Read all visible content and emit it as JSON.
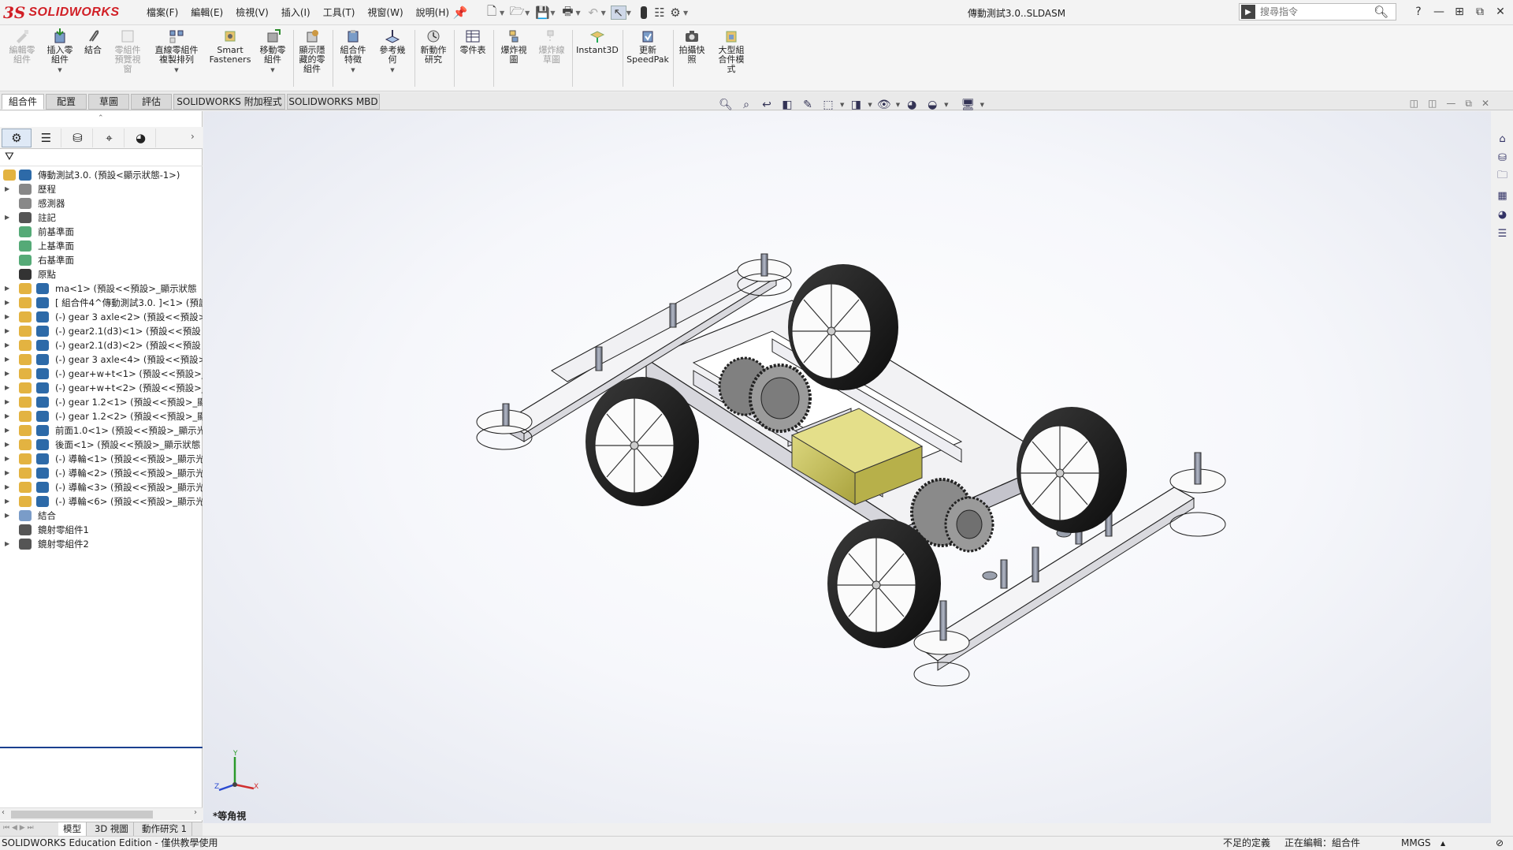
{
  "app": {
    "brand_ds": "3S",
    "brand_name": "SOLIDWORKS",
    "document_title": "傳動測試3.0..SLDASM"
  },
  "menu": [
    "檔案(F)",
    "編輯(E)",
    "檢視(V)",
    "插入(I)",
    "工具(T)",
    "視窗(W)",
    "說明(H)"
  ],
  "search": {
    "placeholder": "搜尋指令"
  },
  "window_controls": [
    "?",
    "—",
    "⊞",
    "⧉",
    "✕"
  ],
  "ribbon": [
    {
      "label": "編輯零\n組件",
      "disabled": true
    },
    {
      "label": "插入零\n組件",
      "disabled": false
    },
    {
      "label": "結合",
      "disabled": false
    },
    {
      "label": "零組件\n預覽視\n窗",
      "disabled": true
    },
    {
      "label": "直線零組件\n複製排列",
      "disabled": false
    },
    {
      "label": "Smart\nFasteners",
      "disabled": false
    },
    {
      "label": "移動零\n組件",
      "disabled": false
    },
    {
      "label": "顯示隱\n藏的零\n組件",
      "disabled": false
    },
    {
      "label": "組合件\n特徵",
      "disabled": false
    },
    {
      "label": "參考幾\n何",
      "disabled": false
    },
    {
      "label": "新動作\n研究",
      "disabled": false
    },
    {
      "label": "零件表",
      "disabled": false
    },
    {
      "label": "爆炸視\n圖",
      "disabled": false
    },
    {
      "label": "爆炸線\n草圖",
      "disabled": true
    },
    {
      "label": "Instant3D",
      "disabled": false
    },
    {
      "label": "更新\nSpeedPak",
      "disabled": false
    },
    {
      "label": "拍攝快\n照",
      "disabled": false
    },
    {
      "label": "大型組\n合件模\n式",
      "disabled": false
    }
  ],
  "command_tabs": [
    "組合件",
    "配置",
    "草圖",
    "評估",
    "SOLIDWORKS 附加程式",
    "SOLIDWORKS MBD"
  ],
  "tree": [
    {
      "label": "傳動測試3.0. (預設<顯示狀態-1>)",
      "kind": "root"
    },
    {
      "label": "歷程",
      "kind": "history"
    },
    {
      "label": "感測器",
      "kind": "sensor"
    },
    {
      "label": "註記",
      "kind": "annotation"
    },
    {
      "label": "前基準面",
      "kind": "plane"
    },
    {
      "label": "上基準面",
      "kind": "plane"
    },
    {
      "label": "右基準面",
      "kind": "plane"
    },
    {
      "label": "原點",
      "kind": "origin"
    },
    {
      "label": "ma<1> (預設<<預設>_顯示狀態",
      "kind": "part"
    },
    {
      "label": "[ 組合件4^傳動測試3.0. ]<1> (預設",
      "kind": "subasm"
    },
    {
      "label": "(-) gear 3 axle<2> (預設<<預設>",
      "kind": "part"
    },
    {
      "label": "(-) gear2.1(d3)<1> (預設<<預設",
      "kind": "part"
    },
    {
      "label": "(-) gear2.1(d3)<2> (預設<<預設",
      "kind": "part"
    },
    {
      "label": "(-) gear 3 axle<4> (預設<<預設>",
      "kind": "part"
    },
    {
      "label": "(-) gear+w+t<1> (預設<<預設>_",
      "kind": "part"
    },
    {
      "label": "(-) gear+w+t<2> (預設<<預設>_",
      "kind": "part"
    },
    {
      "label": "(-) gear 1.2<1> (預設<<預設>_顯",
      "kind": "part"
    },
    {
      "label": "(-) gear 1.2<2> (預設<<預設>_顯",
      "kind": "part"
    },
    {
      "label": "前面1.0<1> (預設<<預設>_顯示光",
      "kind": "part"
    },
    {
      "label": "後面<1> (預設<<預設>_顯示狀態",
      "kind": "part"
    },
    {
      "label": "(-) 導輪<1> (預設<<預設>_顯示光",
      "kind": "part"
    },
    {
      "label": "(-) 導輪<2> (預設<<預設>_顯示光",
      "kind": "part"
    },
    {
      "label": "(-) 導輪<3> (預設<<預設>_顯示光",
      "kind": "part"
    },
    {
      "label": "(-) 導輪<6> (預設<<預設>_顯示光",
      "kind": "part"
    },
    {
      "label": "結合",
      "kind": "mates"
    },
    {
      "label": "鏡射零組件1",
      "kind": "mirror"
    },
    {
      "label": "鏡射零組件2",
      "kind": "mirror"
    }
  ],
  "bottom_tabs": [
    "模型",
    "3D 視圖",
    "動作研究 1"
  ],
  "view_name": "*等角視",
  "triad": {
    "x": "X",
    "y": "Y",
    "z": "Z"
  },
  "status": {
    "edition": "SOLIDWORKS Education Edition - 僅供教學使用",
    "definition": "不足的定義",
    "editing": "正在編輯：組合件",
    "units": "MMGS"
  },
  "colors": {
    "brand": "#d11f26",
    "motor": "#c9c35a",
    "tire": "#1d1d1d",
    "chassis": "#e8e8ea",
    "accent": "#1a3f8f"
  }
}
